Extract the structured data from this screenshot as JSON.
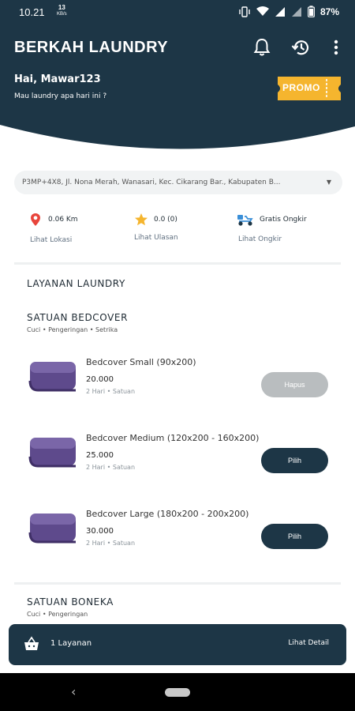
{
  "status": {
    "time": "10.21",
    "net_speed": "13",
    "net_unit": "KB/s",
    "battery": "87%"
  },
  "header": {
    "title": "BERKAH LAUNDRY",
    "greeting": "Hai, Mawar123",
    "subtitle": "Mau laundry apa hari ini ?",
    "promo_label": "PROMO",
    "promo_color": "#f5b52e",
    "bg_color": "#1d3646"
  },
  "address": {
    "text": "P3MP+4X8, Jl. Nona Merah, Wanasari, Kec. Cikarang Bar., Kabupaten B..."
  },
  "info": [
    {
      "value": "0.06 Km",
      "link": "Lihat Lokasi",
      "icon": "location-pin-icon"
    },
    {
      "value": "0.0 (0)",
      "link": "Lihat Ulasan",
      "icon": "star-icon"
    },
    {
      "value": "Gratis Ongkir",
      "link": "Lihat Ongkir",
      "icon": "delivery-scooter-icon"
    }
  ],
  "section_title": "LAYANAN LAUNDRY",
  "groups": [
    {
      "title": "SATUAN  BEDCOVER",
      "subtitle": "Cuci • Pengeringan • Setrika",
      "items": [
        {
          "name": "Bedcover Small (90x200)",
          "price": "20.000",
          "meta": "2 Hari  •  Satuan",
          "button": "Hapus",
          "selected": true
        },
        {
          "name": "Bedcover Medium (120x200 - 160x200)",
          "price": "25.000",
          "meta": "2 Hari  •  Satuan",
          "button": "Pilih",
          "selected": false
        },
        {
          "name": "Bedcover Large (180x200 - 200x200)",
          "price": "30.000",
          "meta": "2 Hari  •  Satuan",
          "button": "Pilih",
          "selected": false
        }
      ]
    },
    {
      "title": "SATUAN BONEKA",
      "subtitle": "Cuci • Pengeringan"
    }
  ],
  "cart": {
    "count_label": "1 Layanan",
    "detail_label": "Lihat Detail"
  }
}
